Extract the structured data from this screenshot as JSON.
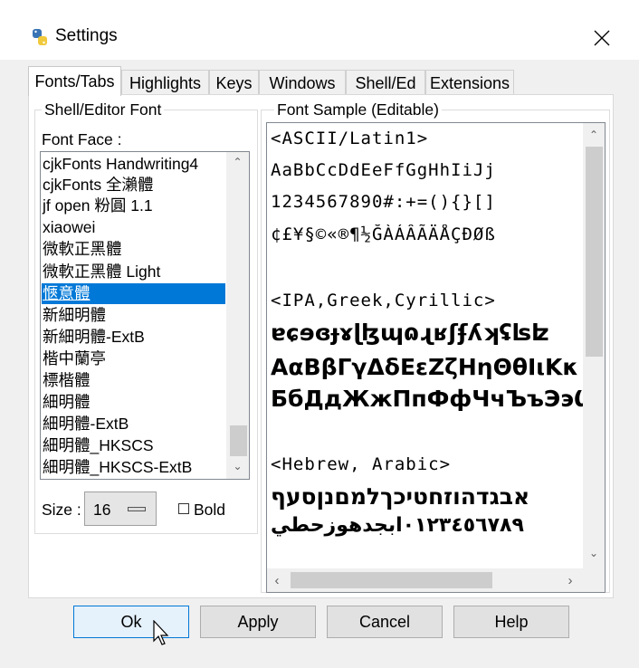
{
  "window": {
    "title": "Settings"
  },
  "tabs": [
    {
      "label": "Fonts/Tabs",
      "active": true
    },
    {
      "label": "Highlights"
    },
    {
      "label": "Keys"
    },
    {
      "label": "Windows"
    },
    {
      "label": "Shell/Ed"
    },
    {
      "label": "Extensions"
    }
  ],
  "font_group": {
    "title": "Shell/Editor Font",
    "face_label": "Font Face :",
    "fonts": [
      "cjkFonts Handwriting4",
      "cjkFonts 全瀨體",
      "jf open 粉圓 1.1",
      "xiaowei",
      "微軟正黑體",
      "微軟正黑體 Light",
      "愜意體",
      "新細明體",
      "新細明體-ExtB",
      "楷中蘭亭",
      "標楷體",
      "細明體",
      "細明體-ExtB",
      "細明體_HKSCS",
      "細明體_HKSCS-ExtB"
    ],
    "selected_index": 6,
    "size_label": "Size :",
    "size_value": "16",
    "bold_label": "Bold",
    "bold_checked": false
  },
  "sample": {
    "title": "Font Sample (Editable)",
    "lines": [
      "<ASCII/Latin1>",
      "AaBbCcDdEeFfGgHhIiJj",
      "1234567890#:+=(){}[]",
      "¢£¥§©«®¶½ĞÀÁÂÃÄÅÇÐØß",
      "",
      "<IPA,Greek,Cyrillic>",
      "ɐɕɘɞɟɤɭɮɰɷɻʁʃʄʎʞʢʪʫ",
      "ΑαΒβΓγΔδΕεΖζΗηΘθΙιΚκ",
      "БбДдЖжПпФфЧчЪъЭэѠѤѬӜ",
      "",
      "<Hebrew, Arabic>",
      "אבגדהוזחטיכךלמםנןסעף",
      "٠١٢٣٤٥٦٧٨٩ابجدهوزحطي"
    ]
  },
  "buttons": {
    "ok": "Ok",
    "apply": "Apply",
    "cancel": "Cancel",
    "help": "Help"
  },
  "colors": {
    "selection": "#0078d7",
    "default_button_border": "#0078d7"
  }
}
